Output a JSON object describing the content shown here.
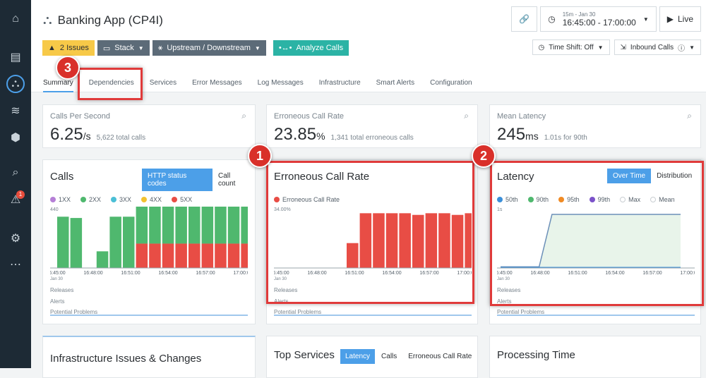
{
  "sidebar": {
    "items": [
      {
        "name": "home-icon",
        "glyph": "⌂"
      },
      {
        "name": "dashboard-icon",
        "glyph": "▤"
      },
      {
        "name": "applications-icon",
        "glyph": "⛬"
      },
      {
        "name": "layers-icon",
        "glyph": "≋"
      },
      {
        "name": "cube-icon",
        "glyph": "⬢"
      },
      {
        "name": "analyze-icon",
        "glyph": "⌕"
      },
      {
        "name": "alerts-icon",
        "glyph": "⚠",
        "badge": "1"
      },
      {
        "name": "settings-icon",
        "glyph": "⚙"
      },
      {
        "name": "more-icon",
        "glyph": "⋯"
      }
    ]
  },
  "header": {
    "title": "Banking App (CP4I)",
    "issues_label": "2 Issues",
    "stack_label": "Stack",
    "updown_label": "Upstream / Downstream",
    "analyze_label": "Analyze Calls",
    "time_range_small": "15m - Jan 30",
    "time_range_big": "16:45:00 - 17:00:00",
    "live_label": "Live",
    "time_shift_label": "Time Shift: Off",
    "inbound_label": "Inbound Calls"
  },
  "tabs": [
    "Summary",
    "Dependencies",
    "Services",
    "Error Messages",
    "Log Messages",
    "Infrastructure",
    "Smart Alerts",
    "Configuration"
  ],
  "metrics": [
    {
      "label": "Calls Per Second",
      "value": "6.25",
      "unit": "/s",
      "sub": "5,622 total calls"
    },
    {
      "label": "Erroneous Call Rate",
      "value": "23.85",
      "unit": "%",
      "sub": "1,341 total erroneous calls"
    },
    {
      "label": "Mean Latency",
      "value": "245",
      "unit": "ms",
      "sub": "1.01s for 90th"
    }
  ],
  "calls_card": {
    "title": "Calls",
    "toggle_on": "HTTP status codes",
    "toggle_off": "Call count",
    "legend": [
      {
        "label": "1XX",
        "color": "#b57fd6"
      },
      {
        "label": "2XX",
        "color": "#4fb86e"
      },
      {
        "label": "3XX",
        "color": "#4bbfd6"
      },
      {
        "label": "4XX",
        "color": "#f2c230"
      },
      {
        "label": "5XX",
        "color": "#e84d45"
      }
    ],
    "ymax_label": "440"
  },
  "err_card": {
    "title": "Erroneous Call Rate",
    "legend": "Erroneous Call Rate",
    "ymax_label": "34.00%"
  },
  "lat_card": {
    "title": "Latency",
    "toggle_on": "Over Time",
    "toggle_off": "Distribution",
    "legend": [
      {
        "label": "50th",
        "color": "#3b8fd9"
      },
      {
        "label": "90th",
        "color": "#4fb86e"
      },
      {
        "label": "95th",
        "color": "#f08a24"
      },
      {
        "label": "99th",
        "color": "#7b52c9"
      },
      {
        "label": "Max",
        "color": "#c9ced2"
      },
      {
        "label": "Mean",
        "color": "#c9ced2"
      }
    ],
    "ymax_label": "1s"
  },
  "rows": {
    "releases": "Releases",
    "alerts": "Alerts",
    "problems": "Potential Problems"
  },
  "bottom": {
    "infra_title": "Infrastructure Issues & Changes",
    "top_services_title": "Top Services",
    "ts_tabs": [
      "Latency",
      "Calls",
      "Erroneous Call Rate"
    ],
    "processing_title": "Processing Time"
  },
  "callouts": [
    "1",
    "2",
    "3"
  ],
  "chart_data": [
    {
      "type": "bar",
      "title": "Calls",
      "x": [
        "16:45:00",
        "16:48:00",
        "16:51:00",
        "16:54:00",
        "16:57:00",
        "17:00:00"
      ],
      "series": [
        {
          "name": "2XX",
          "values": [
            400,
            390,
            0,
            130,
            400,
            400,
            400,
            310,
            300,
            300,
            300,
            300,
            310,
            310,
            300
          ]
        },
        {
          "name": "5XX",
          "values": [
            0,
            0,
            0,
            0,
            0,
            0,
            190,
            190,
            190,
            190,
            190,
            190,
            190,
            190,
            190
          ]
        }
      ],
      "ylim": [
        0,
        440
      ]
    },
    {
      "type": "bar",
      "title": "Erroneous Call Rate",
      "x": [
        "16:45:00",
        "16:48:00",
        "16:51:00",
        "16:54:00",
        "16:57:00",
        "17:00:00"
      ],
      "series": [
        {
          "name": "Erroneous Call Rate",
          "values": [
            0,
            0,
            0,
            0,
            0,
            15,
            33,
            33,
            33,
            33,
            32,
            33,
            33,
            32,
            33
          ]
        }
      ],
      "ylim": [
        0,
        34
      ]
    },
    {
      "type": "line",
      "title": "Latency",
      "x": [
        "16:45:00",
        "16:48:00",
        "16:51:00",
        "16:54:00",
        "16:57:00",
        "17:00:00"
      ],
      "series": [
        {
          "name": "90th",
          "values": [
            0.02,
            0.02,
            0.02,
            0.02,
            0.95,
            0.95,
            0.95,
            0.95,
            0.95,
            0.95,
            0.95,
            0.95,
            0.95,
            0.95,
            0.95
          ]
        },
        {
          "name": "50th",
          "values": [
            0.01,
            0.01,
            0.01,
            0.01,
            0.01,
            0.01,
            0.01,
            0.01,
            0.01,
            0.01,
            0.01,
            0.01,
            0.01,
            0.01,
            0.01
          ]
        }
      ],
      "ylim": [
        0,
        1
      ]
    }
  ]
}
